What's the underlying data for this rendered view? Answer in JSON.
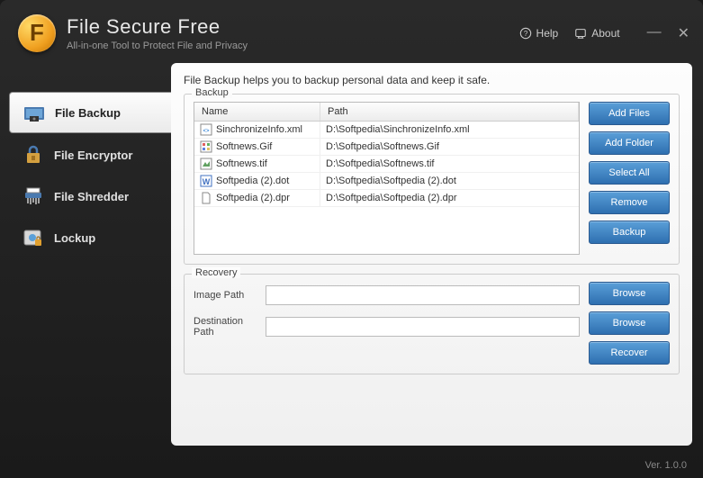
{
  "header": {
    "logo_letter": "F",
    "title": "File Secure Free",
    "subtitle": "All-in-one Tool to Protect File and Privacy",
    "help_label": "Help",
    "about_label": "About"
  },
  "sidebar": {
    "items": [
      {
        "label": "File Backup",
        "active": true
      },
      {
        "label": "File Encryptor",
        "active": false
      },
      {
        "label": "File Shredder",
        "active": false
      },
      {
        "label": "Lockup",
        "active": false
      }
    ]
  },
  "main": {
    "description": "File Backup helps you to backup personal data and keep it safe.",
    "backup": {
      "legend": "Backup",
      "columns": {
        "name": "Name",
        "path": "Path"
      },
      "rows": [
        {
          "name": "SinchronizeInfo.xml",
          "path": "D:\\Softpedia\\SinchronizeInfo.xml",
          "icon": "xml"
        },
        {
          "name": "Softnews.Gif",
          "path": "D:\\Softpedia\\Softnews.Gif",
          "icon": "gif"
        },
        {
          "name": "Softnews.tif",
          "path": "D:\\Softpedia\\Softnews.tif",
          "icon": "tif"
        },
        {
          "name": "Softpedia (2).dot",
          "path": "D:\\Softpedia\\Softpedia (2).dot",
          "icon": "doc"
        },
        {
          "name": "Softpedia (2).dpr",
          "path": "D:\\Softpedia\\Softpedia (2).dpr",
          "icon": "file"
        }
      ],
      "buttons": {
        "add_files": "Add Files",
        "add_folder": "Add Folder",
        "select_all": "Select All",
        "remove": "Remove",
        "backup": "Backup"
      }
    },
    "recovery": {
      "legend": "Recovery",
      "image_path_label": "Image Path",
      "image_path_value": "",
      "destination_label": "Destination Path",
      "destination_value": "",
      "buttons": {
        "browse": "Browse",
        "recover": "Recover"
      }
    }
  },
  "footer": {
    "version": "Ver. 1.0.0"
  }
}
